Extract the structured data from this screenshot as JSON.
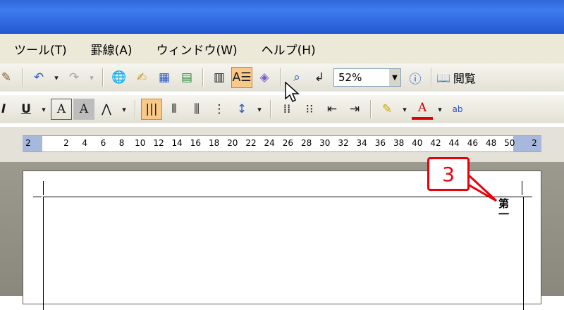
{
  "menu": [
    "ツール(T)",
    "罫線(A)",
    "ウィンドウ(W)",
    "ヘルプ(H)"
  ],
  "toolbar1": {
    "zoom_value": "52%",
    "read_label": "閲覧"
  },
  "toolbar2": {
    "underline": "U",
    "font_color": "A"
  },
  "ruler": {
    "left_label": "2",
    "ticks": [
      "2",
      "4",
      "6",
      "8",
      "10",
      "12",
      "14",
      "16",
      "18",
      "20",
      "22",
      "24",
      "26",
      "28",
      "30",
      "32",
      "34",
      "36",
      "38",
      "40",
      "42",
      "44",
      "46",
      "48",
      "50"
    ],
    "right_label": "2"
  },
  "document": {
    "vertical_text": "第一"
  },
  "callout": {
    "number": "3",
    "color": "#e8000b"
  }
}
